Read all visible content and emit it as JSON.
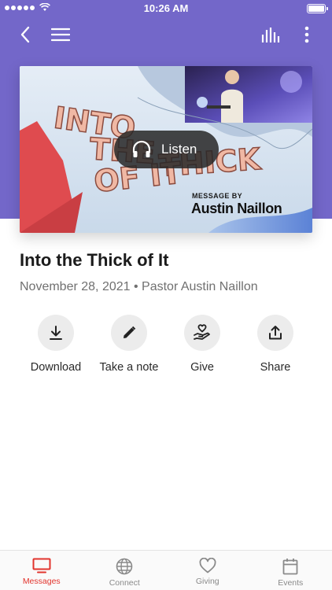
{
  "status_bar": {
    "time": "10:26 AM"
  },
  "nav": {
    "back_icon": "chevron-left-icon",
    "menu_icon": "hamburger-icon",
    "audio_icon": "audio-bars-icon",
    "more_icon": "more-vertical-icon"
  },
  "hero": {
    "artwork_title": "INTO THE THICK OF IT",
    "listen_label": "Listen",
    "byline_label": "MESSAGE BY",
    "speaker_name": "Austin Naillon"
  },
  "message": {
    "title": "Into the Thick of It",
    "meta": "November 28, 2021 • Pastor Austin Naillon"
  },
  "actions": [
    {
      "label": "Download",
      "icon": "download-icon"
    },
    {
      "label": "Take a note",
      "icon": "pencil-icon"
    },
    {
      "label": "Give",
      "icon": "giving-hand-icon"
    },
    {
      "label": "Share",
      "icon": "share-icon"
    }
  ],
  "tabs": [
    {
      "label": "Messages",
      "icon": "tv-icon",
      "active": true
    },
    {
      "label": "Connect",
      "icon": "globe-icon",
      "active": false
    },
    {
      "label": "Giving",
      "icon": "heart-icon",
      "active": false
    },
    {
      "label": "Events",
      "icon": "calendar-icon",
      "active": false
    }
  ],
  "colors": {
    "header": "#7367c9",
    "accent": "#e2342d",
    "inactive_tab": "#8a8a8a"
  }
}
